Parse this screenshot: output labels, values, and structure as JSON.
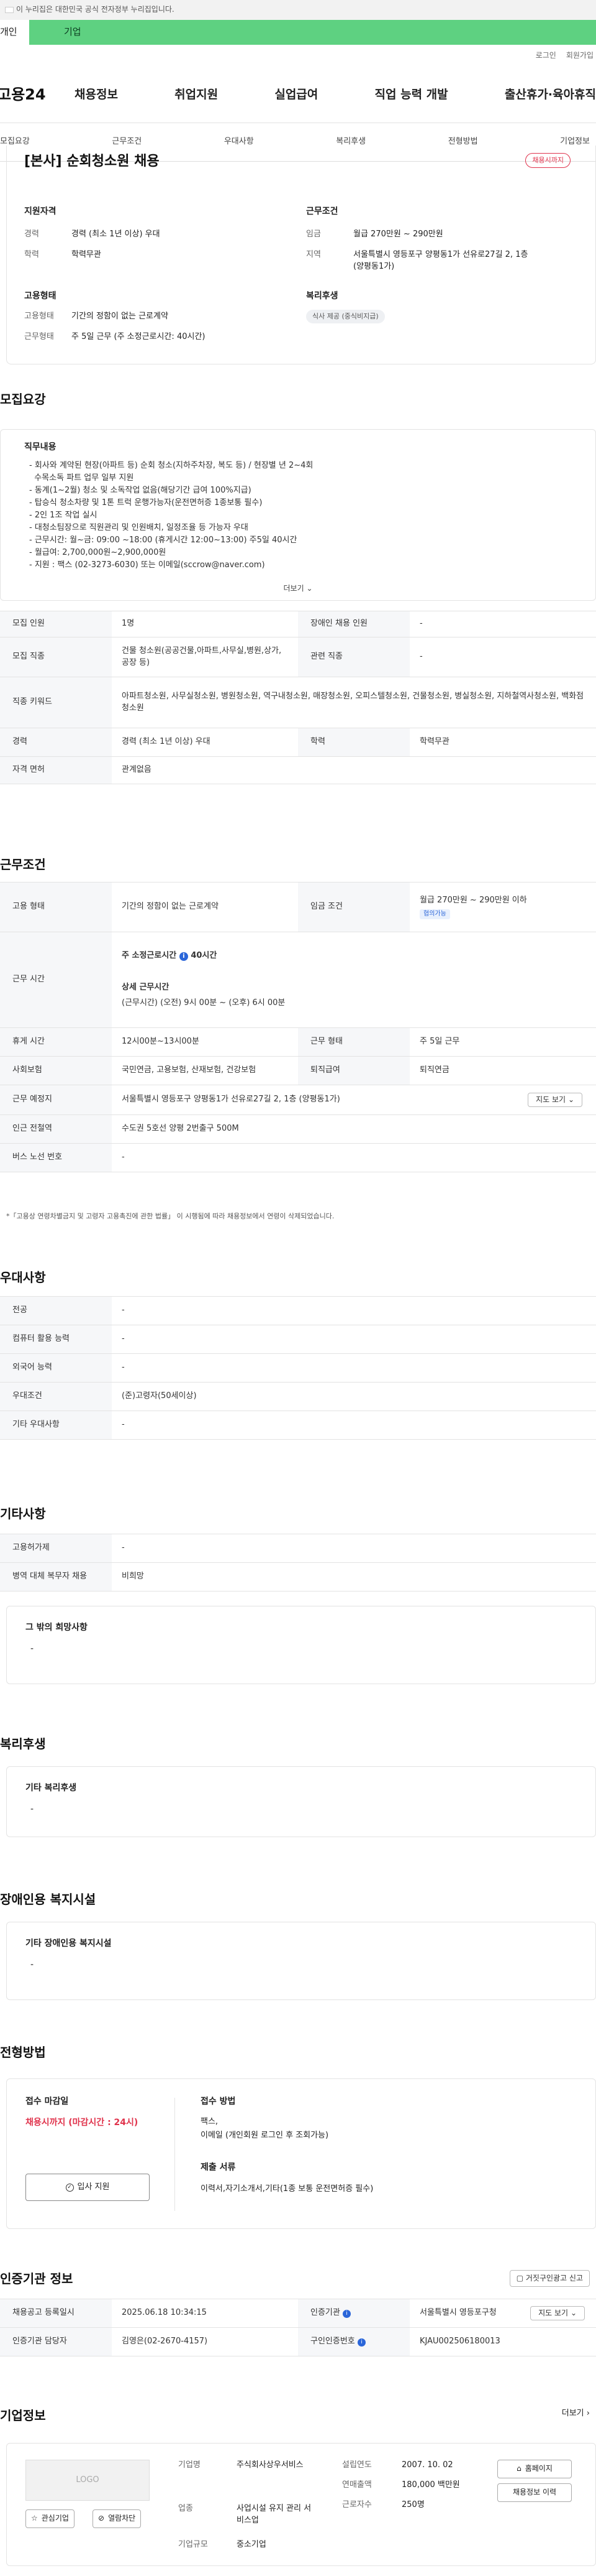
{
  "gov_banner": "이 누리집은 대한민국 공식 전자정부 누리집입니다.",
  "tabs": [
    "개인",
    "기업"
  ],
  "top_links": [
    "로그인",
    "회원가입"
  ],
  "logo": "고용24",
  "gnb": [
    "채용정보",
    "취업지원",
    "실업급여",
    "직업 능력 개발",
    "출산휴가·육아휴직"
  ],
  "subnav": [
    "모집요강",
    "근무조건",
    "우대사항",
    "복리후생",
    "전형방법",
    "기업정보"
  ],
  "job": {
    "title": "[본사] 순회청소원 채용",
    "status_badge": "채용시까지",
    "qual_title": "지원자격",
    "qual": [
      {
        "k": "경력",
        "v": "경력 (최소 1년 이상) 우대"
      },
      {
        "k": "학력",
        "v": "학력무관"
      }
    ],
    "cond_title": "근무조건",
    "cond": [
      {
        "k": "임금",
        "v": "월급 270만원 ~ 290만원"
      },
      {
        "k": "지역",
        "v": "서울특별시 영등포구 양평동1가 선유로27길 2, 1층 (양평동1가)"
      }
    ],
    "emp_title": "고용형태",
    "emp": [
      {
        "k": "고용형태",
        "v": "기간의 정함이 없는 근로계약"
      },
      {
        "k": "근무형태",
        "v": "주 5일 근무 (주 소정근로시간: 40시간)"
      }
    ],
    "welfare_title": "복리후생",
    "welfare_pill": "식사 제공 (중식비지급)"
  },
  "recruit": {
    "section_title": "모집요강",
    "desc_title": "직무내용",
    "desc": "- 회사와 계약된 현장(아파트 등) 순회 청소(지하주차장, 복도 등) / 현장별 년 2~4회\n  수목소독 파트 업무 일부 지원\n- 동계(1~2월) 청소 및 소독작업 없음(해당기간 급여 100%지급)\n- 탑승식 청소차량 및 1톤 트럭 운행가능자(운전면허증 1종보통 필수)\n- 2인 1조 작업 실시\n- 대청소팀장으로 직원관리 및 인원배치, 일정조율 등 가능자 우대\n- 근무시간: 월~금: 09:00 ~18:00 (휴게시간 12:00~13:00) 주5일 40시간\n- 월급여: 2,700,000원~2,900,000원\n- 지원 : 팩스 (02-3273-6030) 또는 이메일(sccrow@naver.com)",
    "more": "더보기",
    "rows": [
      {
        "k1": "모집 인원",
        "v1": "1명",
        "k2": "장애인 채용 인원",
        "v2": "-"
      },
      {
        "k1": "모집 직종",
        "v1": "건물 청소원(공공건물,아파트,사무실,병원,상가,공장 등)",
        "k2": "관련 직종",
        "v2": "-"
      },
      {
        "k1": "직종 키워드",
        "v1": "아파트청소원, 사무실청소원, 병원청소원, 역구내청소원, 매장청소원, 오피스텔청소원, 건물청소원, 병실청소원, 지하철역사청소원, 백화점청소원",
        "k2": "",
        "v2": ""
      },
      {
        "k1": "경력",
        "v1": "경력 (최소 1년 이상) 우대",
        "k2": "학력",
        "v2": "학력무관"
      },
      {
        "k1": "자격 면허",
        "v1": "관계없음",
        "k2": "",
        "v2": ""
      }
    ]
  },
  "work": {
    "section_title": "근무조건",
    "emp_k": "고용 형태",
    "emp_v": "기간의 정함이 없는 근로계약",
    "wage_k": "임금 조건",
    "wage_v": "월급 270만원 ~ 290만원 이하",
    "wage_tag": "협의가능",
    "time_k": "근무 시간",
    "time_v1": "주 소정근로시간",
    "time_v1b": "40시간",
    "time_v2": "상세 근무시간",
    "time_v3": "(근무시간) (오전) 9시 00분 ~ (오후) 6시 00분",
    "break_k": "휴게 시간",
    "break_v": "12시00분~13시00분",
    "form_k": "근무 형태",
    "form_v": "주 5일 근무",
    "ins_k": "사회보험",
    "ins_v": "국민연금, 고용보험, 산재보험, 건강보험",
    "ret_k": "퇴직급여",
    "ret_v": "퇴직연금",
    "loc_k": "근무 예정지",
    "loc_v": "서울특별시 영등포구 양평동1가 선유로27길 2, 1층 (양평동1가)",
    "map_btn": "지도 보기",
    "sub_k": "인근 전철역",
    "sub_v": "수도권 5호선 양평 2번출구 500M",
    "bus_k": "버스 노선 번호",
    "bus_v": "-",
    "note": "*「고용상 연령차별금지 및 고령자 고용촉진에 관한 법률」 이 시행됨에 따라 채용정보에서 연령이 삭제되었습니다."
  },
  "pref": {
    "section_title": "우대사항",
    "rows": [
      {
        "k": "전공",
        "v": "-"
      },
      {
        "k": "컴퓨터 활용 능력",
        "v": "-"
      },
      {
        "k": "외국어 능력",
        "v": "-"
      },
      {
        "k": "우대조건",
        "v": "(준)고령자(50세이상)"
      },
      {
        "k": "기타 우대사항",
        "v": "-"
      }
    ]
  },
  "etc": {
    "section_title": "기타사항",
    "rows": [
      {
        "k": "고용허가제",
        "v": "-"
      },
      {
        "k": "병역 대체 복무자 채용",
        "v": "비희망"
      }
    ],
    "hope_title": "그 밖의 희망사항",
    "hope_v": "-"
  },
  "welfare": {
    "section_title": "복리후생",
    "box_title": "기타 복리후생",
    "box_v": "-"
  },
  "disabled": {
    "section_title": "장애인용 복지시설",
    "box_title": "기타 장애인용 복지시설",
    "box_v": "-"
  },
  "selection": {
    "section_title": "전형방법",
    "deadline_title": "접수 마감일",
    "deadline_v": "채용시까지 (마감시간 : 24시)",
    "apply_btn": "입사 지원",
    "method_title": "접수 방법",
    "method_v1": "팩스,",
    "method_v2": "이메일 (개인회원 로그인 후 조회가능)",
    "docs_title": "제출 서류",
    "docs_v": "이력서,자기소개서,기타(1종 보통 운전면허증 필수)"
  },
  "cert": {
    "section_title": "인증기관 정보",
    "report_btn": "거짓구인광고 신고",
    "r1": {
      "k1": "채용공고 등록일시",
      "v1": "2025.06.18 10:34:15",
      "k2": "인증기관",
      "v2": "서울특별시 영등포구청",
      "btn": "지도 보기"
    },
    "r2": {
      "k1": "인증기관 담당자",
      "v1": "김영은(02-2670-4157)",
      "k2": "구인인증번호",
      "v2": "KJAU002506180013"
    }
  },
  "company": {
    "section_title": "기업정보",
    "more": "더보기",
    "logo": "LOGO",
    "interest_btn": "관심기업",
    "block_btn": "열람차단",
    "f1k": "기업명",
    "f1v": "주식회사상우서비스",
    "f2k": "업종",
    "f2v": "사업시설 유지 관리 서비스업",
    "f3k": "기업규모",
    "f3v": "중소기업",
    "f4k": "설립연도",
    "f4v": "2007. 10. 02",
    "f5k": "연매출액",
    "f5v": "180,000 백만원",
    "f6k": "근로자수",
    "f6v": "250명",
    "homepage_btn": "홈페이지",
    "jobs_btn": "채용정보 이력"
  }
}
